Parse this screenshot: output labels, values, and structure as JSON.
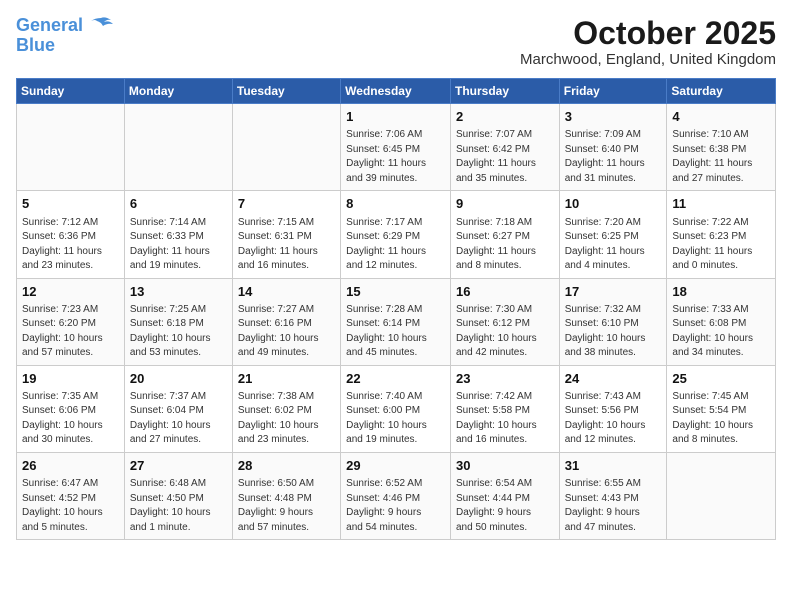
{
  "header": {
    "logo_line1": "General",
    "logo_line2": "Blue",
    "month_title": "October 2025",
    "location": "Marchwood, England, United Kingdom"
  },
  "weekdays": [
    "Sunday",
    "Monday",
    "Tuesday",
    "Wednesday",
    "Thursday",
    "Friday",
    "Saturday"
  ],
  "weeks": [
    [
      {
        "day": "",
        "info": ""
      },
      {
        "day": "",
        "info": ""
      },
      {
        "day": "",
        "info": ""
      },
      {
        "day": "1",
        "info": "Sunrise: 7:06 AM\nSunset: 6:45 PM\nDaylight: 11 hours\nand 39 minutes."
      },
      {
        "day": "2",
        "info": "Sunrise: 7:07 AM\nSunset: 6:42 PM\nDaylight: 11 hours\nand 35 minutes."
      },
      {
        "day": "3",
        "info": "Sunrise: 7:09 AM\nSunset: 6:40 PM\nDaylight: 11 hours\nand 31 minutes."
      },
      {
        "day": "4",
        "info": "Sunrise: 7:10 AM\nSunset: 6:38 PM\nDaylight: 11 hours\nand 27 minutes."
      }
    ],
    [
      {
        "day": "5",
        "info": "Sunrise: 7:12 AM\nSunset: 6:36 PM\nDaylight: 11 hours\nand 23 minutes."
      },
      {
        "day": "6",
        "info": "Sunrise: 7:14 AM\nSunset: 6:33 PM\nDaylight: 11 hours\nand 19 minutes."
      },
      {
        "day": "7",
        "info": "Sunrise: 7:15 AM\nSunset: 6:31 PM\nDaylight: 11 hours\nand 16 minutes."
      },
      {
        "day": "8",
        "info": "Sunrise: 7:17 AM\nSunset: 6:29 PM\nDaylight: 11 hours\nand 12 minutes."
      },
      {
        "day": "9",
        "info": "Sunrise: 7:18 AM\nSunset: 6:27 PM\nDaylight: 11 hours\nand 8 minutes."
      },
      {
        "day": "10",
        "info": "Sunrise: 7:20 AM\nSunset: 6:25 PM\nDaylight: 11 hours\nand 4 minutes."
      },
      {
        "day": "11",
        "info": "Sunrise: 7:22 AM\nSunset: 6:23 PM\nDaylight: 11 hours\nand 0 minutes."
      }
    ],
    [
      {
        "day": "12",
        "info": "Sunrise: 7:23 AM\nSunset: 6:20 PM\nDaylight: 10 hours\nand 57 minutes."
      },
      {
        "day": "13",
        "info": "Sunrise: 7:25 AM\nSunset: 6:18 PM\nDaylight: 10 hours\nand 53 minutes."
      },
      {
        "day": "14",
        "info": "Sunrise: 7:27 AM\nSunset: 6:16 PM\nDaylight: 10 hours\nand 49 minutes."
      },
      {
        "day": "15",
        "info": "Sunrise: 7:28 AM\nSunset: 6:14 PM\nDaylight: 10 hours\nand 45 minutes."
      },
      {
        "day": "16",
        "info": "Sunrise: 7:30 AM\nSunset: 6:12 PM\nDaylight: 10 hours\nand 42 minutes."
      },
      {
        "day": "17",
        "info": "Sunrise: 7:32 AM\nSunset: 6:10 PM\nDaylight: 10 hours\nand 38 minutes."
      },
      {
        "day": "18",
        "info": "Sunrise: 7:33 AM\nSunset: 6:08 PM\nDaylight: 10 hours\nand 34 minutes."
      }
    ],
    [
      {
        "day": "19",
        "info": "Sunrise: 7:35 AM\nSunset: 6:06 PM\nDaylight: 10 hours\nand 30 minutes."
      },
      {
        "day": "20",
        "info": "Sunrise: 7:37 AM\nSunset: 6:04 PM\nDaylight: 10 hours\nand 27 minutes."
      },
      {
        "day": "21",
        "info": "Sunrise: 7:38 AM\nSunset: 6:02 PM\nDaylight: 10 hours\nand 23 minutes."
      },
      {
        "day": "22",
        "info": "Sunrise: 7:40 AM\nSunset: 6:00 PM\nDaylight: 10 hours\nand 19 minutes."
      },
      {
        "day": "23",
        "info": "Sunrise: 7:42 AM\nSunset: 5:58 PM\nDaylight: 10 hours\nand 16 minutes."
      },
      {
        "day": "24",
        "info": "Sunrise: 7:43 AM\nSunset: 5:56 PM\nDaylight: 10 hours\nand 12 minutes."
      },
      {
        "day": "25",
        "info": "Sunrise: 7:45 AM\nSunset: 5:54 PM\nDaylight: 10 hours\nand 8 minutes."
      }
    ],
    [
      {
        "day": "26",
        "info": "Sunrise: 6:47 AM\nSunset: 4:52 PM\nDaylight: 10 hours\nand 5 minutes."
      },
      {
        "day": "27",
        "info": "Sunrise: 6:48 AM\nSunset: 4:50 PM\nDaylight: 10 hours\nand 1 minute."
      },
      {
        "day": "28",
        "info": "Sunrise: 6:50 AM\nSunset: 4:48 PM\nDaylight: 9 hours\nand 57 minutes."
      },
      {
        "day": "29",
        "info": "Sunrise: 6:52 AM\nSunset: 4:46 PM\nDaylight: 9 hours\nand 54 minutes."
      },
      {
        "day": "30",
        "info": "Sunrise: 6:54 AM\nSunset: 4:44 PM\nDaylight: 9 hours\nand 50 minutes."
      },
      {
        "day": "31",
        "info": "Sunrise: 6:55 AM\nSunset: 4:43 PM\nDaylight: 9 hours\nand 47 minutes."
      },
      {
        "day": "",
        "info": ""
      }
    ]
  ]
}
